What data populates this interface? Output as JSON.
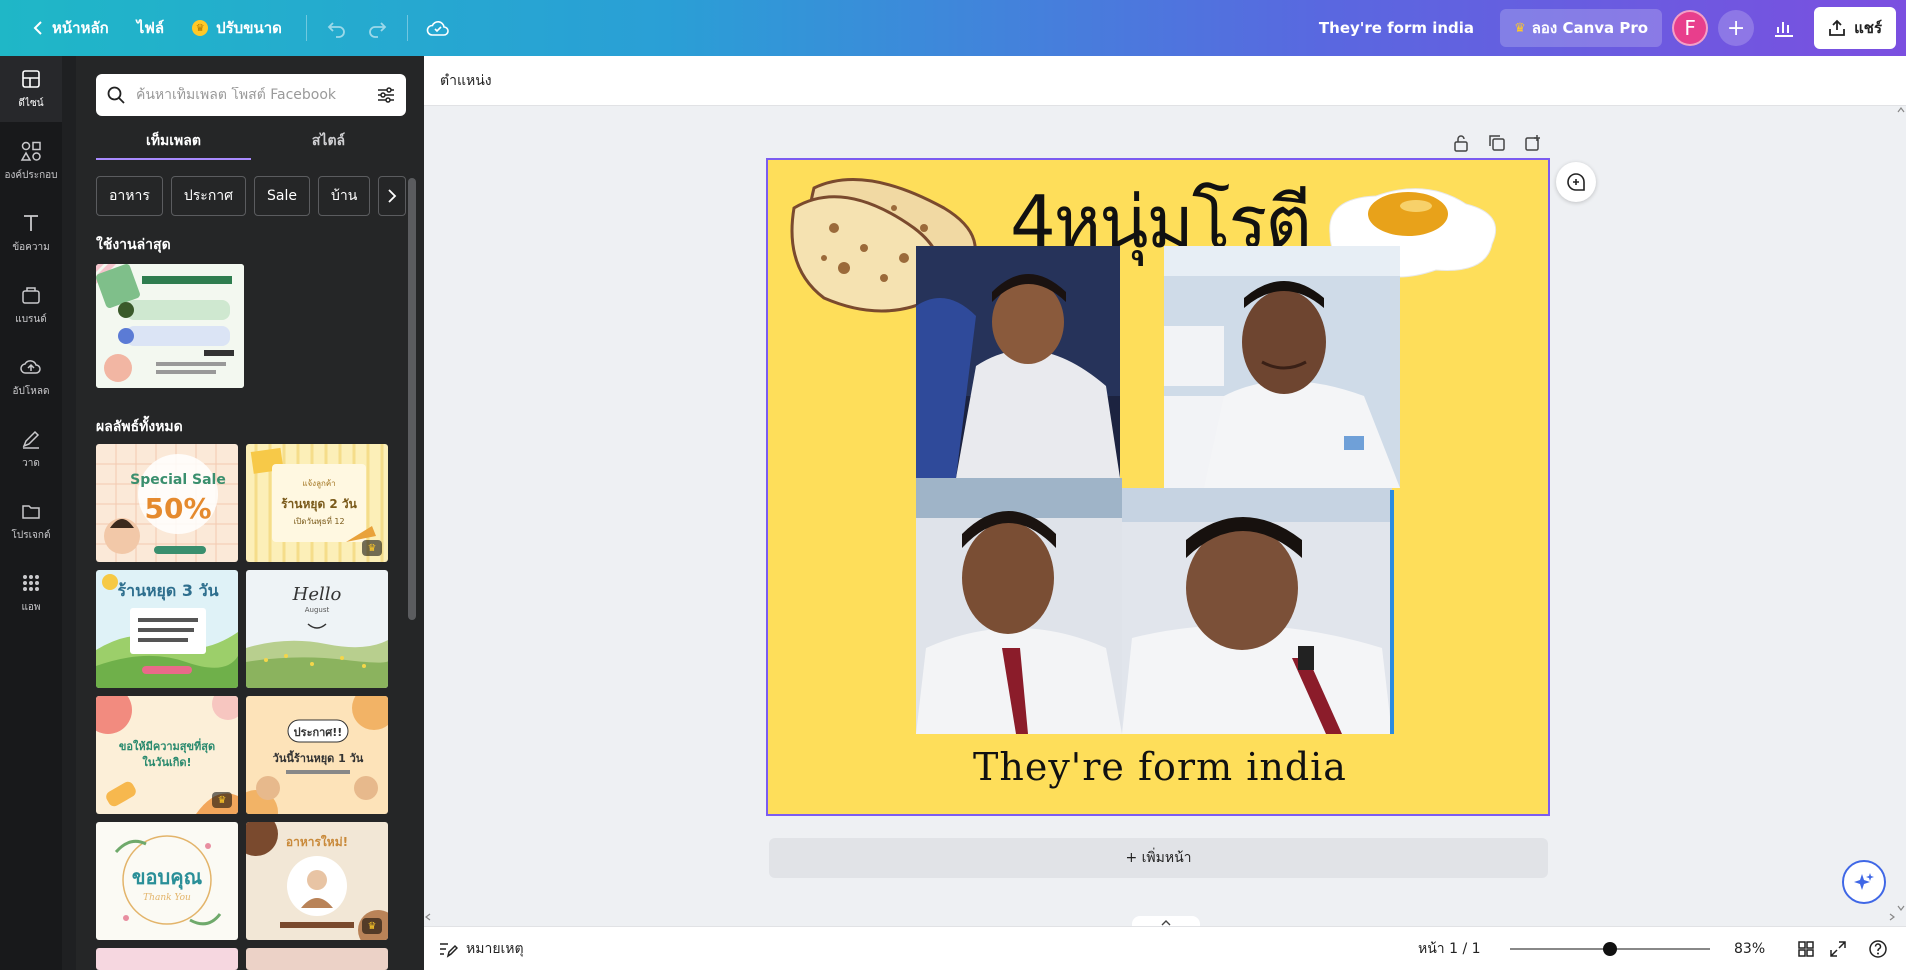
{
  "topbar": {
    "home_label": "หน้าหลัก",
    "file_label": "ไฟล์",
    "resize_label": "ปรับขนาด",
    "doc_title": "They're form india",
    "pro_label": "ลอง Canva Pro",
    "avatar_letter": "F",
    "share_label": "แชร์"
  },
  "rail": {
    "items": [
      {
        "label": "ดีไซน์",
        "icon": "layout-icon"
      },
      {
        "label": "องค์ประกอบ",
        "icon": "elements-icon"
      },
      {
        "label": "ข้อความ",
        "icon": "text-icon"
      },
      {
        "label": "แบรนด์",
        "icon": "brand-icon"
      },
      {
        "label": "อัปโหลด",
        "icon": "upload-icon"
      },
      {
        "label": "วาด",
        "icon": "draw-icon"
      },
      {
        "label": "โปรเจกต์",
        "icon": "folder-icon"
      },
      {
        "label": "แอพ",
        "icon": "apps-icon"
      }
    ]
  },
  "panel": {
    "search_placeholder": "ค้นหาเท็มเพลต โพสต์ Facebook",
    "tabs": [
      "เท็มเพลต",
      "สไตล์"
    ],
    "chips": [
      "อาหาร",
      "ประกาศ",
      "Sale",
      "บ้าน"
    ],
    "recent_title": "ใช้งานล่าสุด",
    "all_results_title": "ผลลัพธ์ทั้งหมด"
  },
  "editor": {
    "position_label": "ตำแหน่ง",
    "add_page_label": "+ เพิ่มหน้า"
  },
  "design": {
    "title": "4หนุ่มโรตี",
    "caption": "They're form india",
    "background": "#fede5a",
    "selection_color": "#7c5cf0"
  },
  "bottombar": {
    "notes_label": "หมายเหตุ",
    "page_count": "หน้า 1 / 1",
    "zoom": "83%",
    "zoom_fraction": 0.5
  }
}
